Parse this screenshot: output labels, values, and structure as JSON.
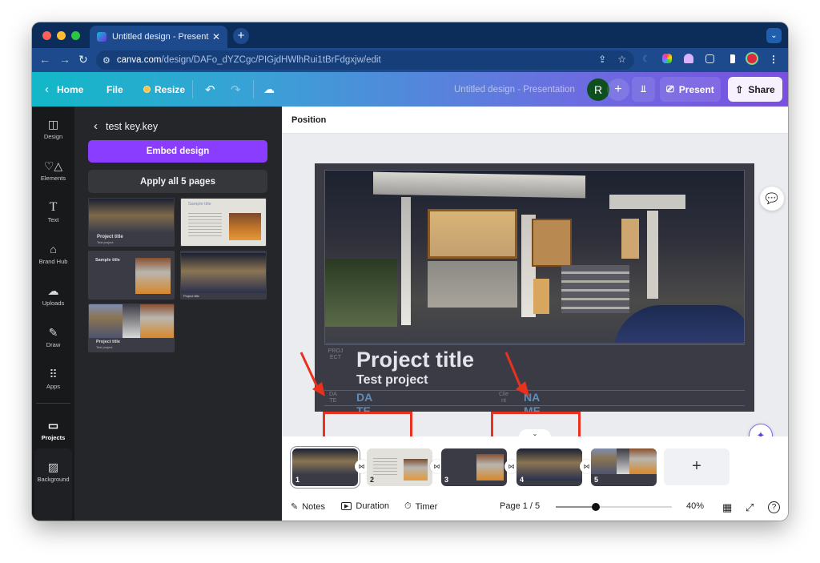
{
  "browser": {
    "tab_title": "Untitled design - Presentation",
    "url_domain": "canva.com",
    "url_path": "/design/DAFo_dYZCgc/PIGjdHWlhRui1tBrFdgxjw/edit",
    "traffic_lights": [
      "#ff5f57",
      "#febc2e",
      "#28c840"
    ]
  },
  "header": {
    "home": "Home",
    "file": "File",
    "resize": "Resize",
    "doc_title": "Untitled design - Presentation",
    "avatar_initial": "R",
    "present": "Present",
    "share": "Share"
  },
  "rail": {
    "items": [
      {
        "label": "Design",
        "icon": "layout-icon"
      },
      {
        "label": "Elements",
        "icon": "shapes-icon"
      },
      {
        "label": "Text",
        "icon": "text-icon"
      },
      {
        "label": "Brand Hub",
        "icon": "brand-icon"
      },
      {
        "label": "Uploads",
        "icon": "upload-icon"
      },
      {
        "label": "Draw",
        "icon": "draw-icon"
      },
      {
        "label": "Apps",
        "icon": "apps-icon"
      },
      {
        "label": "Projects",
        "icon": "folder-icon"
      },
      {
        "label": "Background",
        "icon": "background-icon"
      }
    ]
  },
  "panel": {
    "back_title": "test key.key",
    "embed_button": "Embed design",
    "apply_button": "Apply all 5 pages",
    "thumbs": [
      {
        "title": "Project title",
        "sub": "Test project",
        "theme": "dark-photo"
      },
      {
        "title": "Sample title",
        "theme": "light"
      },
      {
        "title": "Sample title",
        "theme": "dark"
      },
      {
        "title": "Project title",
        "theme": "dark-photo"
      },
      {
        "title": "Project title",
        "sub": "Test project",
        "theme": "collage"
      }
    ]
  },
  "toolbar": {
    "position": "Position"
  },
  "slide": {
    "project_tag": "PROJ ECT",
    "title": "Project title",
    "subtitle": "Test project",
    "date_tag": "DA TE",
    "date_value_1": "DA",
    "date_value_2": "TE",
    "client_tag": "Clie nt",
    "name_value_1": "NA",
    "name_value_2": "ME",
    "accent_color": "#5f8db8",
    "annotation_color": "#e8321f"
  },
  "filmstrip": {
    "pages": [
      "1",
      "2",
      "3",
      "4",
      "5"
    ],
    "add_page": "+"
  },
  "bottom": {
    "notes": "Notes",
    "duration": "Duration",
    "timer": "Timer",
    "page": "Page 1 / 5",
    "zoom": "40%",
    "zoom_percent": 40
  }
}
